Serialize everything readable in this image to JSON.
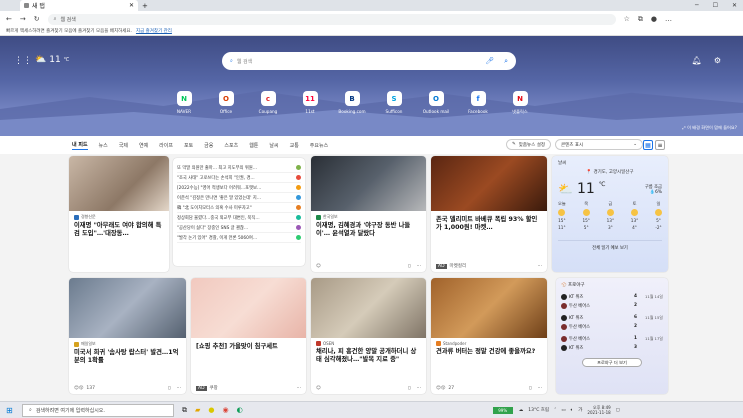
{
  "browser": {
    "tab_title": "새 탭",
    "url_placeholder": "웹 검색",
    "favbar_text": "빠르게 액세스하려면 즐겨찾기 모음에 즐겨찾기 모음을 배치하세요.",
    "favbar_link": "지금 즐겨찾기 관리"
  },
  "hero": {
    "temp": "11",
    "unit": "℃",
    "search_placeholder": "웹 검색",
    "caption": "이 배경 화면이 맘에 들어요?",
    "tiles": [
      {
        "label": "NAVER",
        "glyph": "N",
        "color": "#03c75a"
      },
      {
        "label": "Office",
        "glyph": "O",
        "color": "#d83b01"
      },
      {
        "label": "Coupang",
        "glyph": "c",
        "color": "#e52528"
      },
      {
        "label": "11st",
        "glyph": "11",
        "color": "#ff0038"
      },
      {
        "label": "Booking.com",
        "glyph": "B",
        "color": "#003580"
      },
      {
        "label": "Sufficon",
        "glyph": "S",
        "color": "#00a3e0"
      },
      {
        "label": "Outlook mail",
        "glyph": "O",
        "color": "#0078d4"
      },
      {
        "label": "Facebook",
        "glyph": "f",
        "color": "#1877f2"
      },
      {
        "label": "넷플릭스",
        "glyph": "N",
        "color": "#e50914"
      }
    ]
  },
  "nav": {
    "items": [
      "내 피드",
      "뉴스",
      "국제",
      "연예",
      "라이프",
      "포토",
      "금융",
      "스포츠",
      "웹툰",
      "날씨",
      "교통",
      "주요뉴스"
    ],
    "personalize": "맞춤뉴스 설정",
    "content_visible": "콘텐츠 표시"
  },
  "cards": {
    "c1": {
      "source": "경향신문",
      "title": "이재명 \"아무래도 여야 합의해 특검 도입\"…'대장동…"
    },
    "c2": {
      "source": "한국일보",
      "title": "이재명, 김혜경과 '야구장 동반 나들이'… 윤석열과 달랐다"
    },
    "c3": {
      "source": "",
      "title": "존국 델리미트 바베큐 폭립 93% 할인가 1,000원! 마켓…",
      "ad": "AD",
      "ad_source": "마켓컬리"
    },
    "c4": {
      "source": "매일일보",
      "title": "미국서 희귀 '솜사탕 랍스터' 발견…1억분의 1확률",
      "reactions": "137"
    },
    "c5": {
      "source": "",
      "title": "[쇼핑 추천] 가을맞이 침구세트",
      "ad": "AD",
      "ad_source": "쿠팡"
    },
    "c6": {
      "source": "OSEN",
      "title": "채리나, 피 흥건한 양말 공개하더니 상태 심각해졌나…\"발목 지료 중\""
    },
    "c7": {
      "source": "Standpoder",
      "title": "견과류 버터는 정말 건강에 좋을까요?",
      "reactions": "27"
    }
  },
  "list": [
    "또 막말 의원만 출마… 최고 지도부의 위원…",
    "\"조국 사태\" 고로쓰다는 손석희 \"인권, 경…",
    "[2022수능] \"영어 적생보다 어려워…포맷보…",
    "이준석 \"김정은 만나면 '좋은 말 있었는데' 지…",
    "韓 \"北 도이치모터스 의혹 수사 미루자고\"",
    "정상회담 울렸다…중국 외교부 대변인, 묵직…",
    "\"공산당이 싫다\" 장중인 SNS 글 괜찮…",
    "\"발각 논기 있어\" 경찰, 이게 언론 5060여…"
  ],
  "weather": {
    "title": "날씨",
    "location": "경기도, 고양시일산구",
    "temp": "11",
    "unit": "℃",
    "condition": "구름 조금",
    "precip": "6%",
    "forecast": [
      {
        "day": "오늘",
        "hi": "15°",
        "lo": "11°"
      },
      {
        "day": "목",
        "hi": "15°",
        "lo": "5°"
      },
      {
        "day": "금",
        "hi": "13°",
        "lo": "3°"
      },
      {
        "day": "토",
        "hi": "13°",
        "lo": "4°"
      },
      {
        "day": "일",
        "hi": "5°",
        "lo": "-2°"
      }
    ],
    "more": "전체 일기 예보 보기"
  },
  "sports": {
    "title": "프로야구",
    "more": "프로야구 더 보기",
    "games": [
      {
        "team": "KT 위즈",
        "score": "4",
        "date": "완료",
        "date2": "11월 14일"
      },
      {
        "team": "두산 베어스",
        "score": "2",
        "date": "",
        "": ""
      },
      {
        "team": "KT 위즈",
        "score": "6",
        "date": "완료",
        "date2": "11월 15일"
      },
      {
        "team": "두산 베어스",
        "score": "2",
        "date": ""
      },
      {
        "team": "두산 베어스",
        "score": "1",
        "date": "완료",
        "date2": "11월 17일"
      },
      {
        "team": "KT 위즈",
        "score": "3",
        "date": ""
      }
    ]
  },
  "taskbar": {
    "search": "검색하려면 여기에 입력하십시오.",
    "weather": "13°C 흐림",
    "battery": "99%",
    "time": "오후 8:49",
    "date": "2021-11-18"
  }
}
